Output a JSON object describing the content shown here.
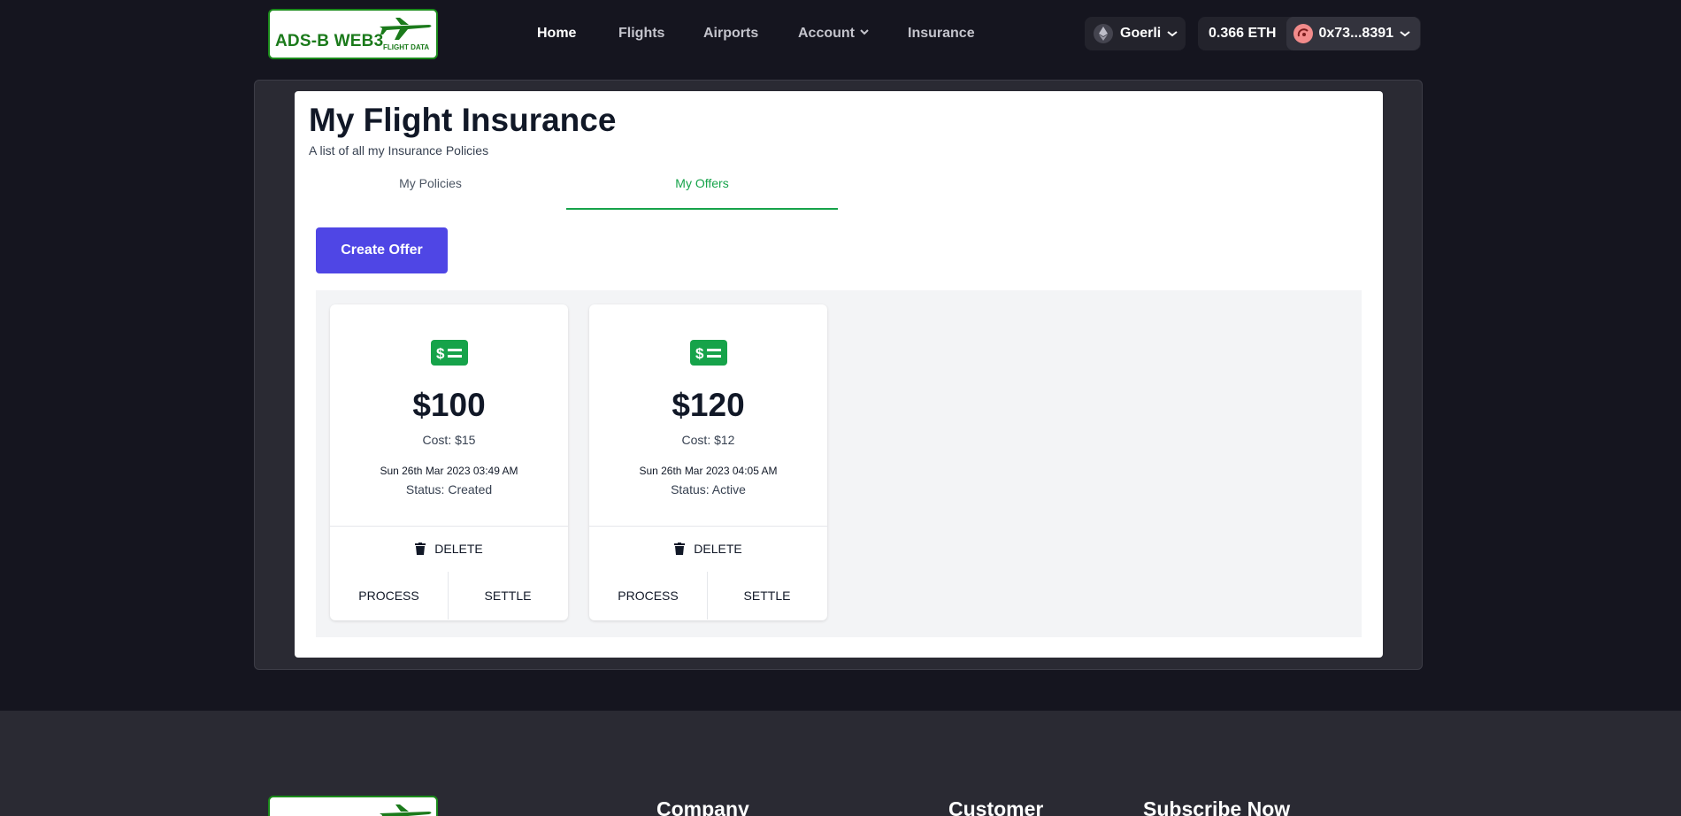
{
  "header": {
    "logo_text": "ADS-B WEB3",
    "logo_sub": "FLIGHT DATA",
    "nav": [
      {
        "label": "Home"
      },
      {
        "label": "Flights"
      },
      {
        "label": "Airports"
      },
      {
        "label": "Account"
      },
      {
        "label": "Insurance"
      }
    ],
    "network": "Goerli",
    "balance": "0.366 ETH",
    "account": "0x73...8391"
  },
  "page": {
    "title": "My Flight Insurance",
    "subtitle": "A list of all my Insurance Policies",
    "tabs": [
      {
        "label": "My Policies"
      },
      {
        "label": "My Offers"
      }
    ],
    "active_tab": "My Offers",
    "create_button": "Create Offer"
  },
  "offers": [
    {
      "amount": "$100",
      "cost": "Cost: $15",
      "date": "Sun 26th Mar 2023 03:49 AM",
      "status": "Status: Created",
      "delete_label": "DELETE",
      "process_label": "PROCESS",
      "settle_label": "SETTLE"
    },
    {
      "amount": "$120",
      "cost": "Cost: $12",
      "date": "Sun 26th Mar 2023 04:05 AM",
      "status": "Status: Active",
      "delete_label": "DELETE",
      "process_label": "PROCESS",
      "settle_label": "SETTLE"
    }
  ],
  "footer": {
    "headings": [
      "Company",
      "Customer",
      "Subscribe Now"
    ]
  },
  "colors": {
    "background": "#15151f",
    "accent": "#4f46e5",
    "brand_green": "#16a34a",
    "logo_green": "#1b7a1b"
  },
  "icons": [
    "airplane-icon",
    "ethereum-icon",
    "chevron-down-icon",
    "avatar-icon",
    "money-bill-icon",
    "trash-icon"
  ]
}
